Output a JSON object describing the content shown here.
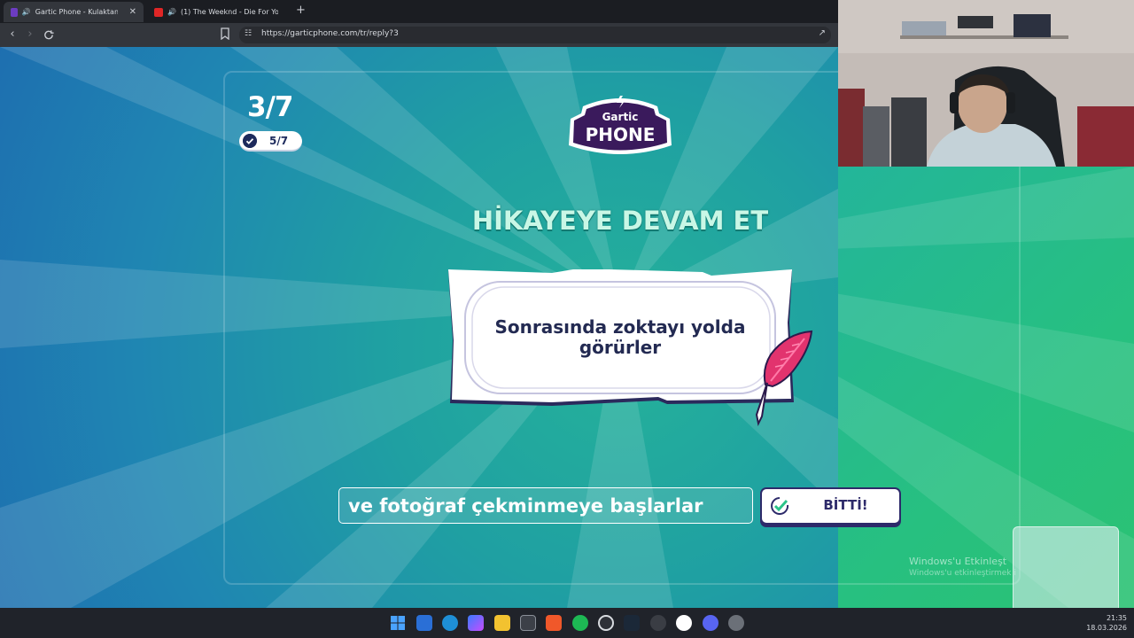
{
  "browser": {
    "tabs": [
      {
        "title": "Gartic Phone - Kulaktan Kulağ",
        "active": true,
        "favicon_color": "#6c3cc2"
      },
      {
        "title": "(1) The Weeknd - Die For You (Ly",
        "active": false,
        "favicon_color": "#e02626"
      }
    ],
    "new_tab": "+",
    "url": "https://garticphone.com/tr/reply?3"
  },
  "game": {
    "round_counter": "3/7",
    "done_count": "5/7",
    "logo_top": "Gartic",
    "logo_bottom": "PHONE",
    "heading": "HİKAYEYE DEVAM ET",
    "prompt_text": "Sonrasında zoktayı yolda görürler",
    "answer_value": "ve fotoğraf çekminmeye başlarlar",
    "done_button_label": "BİTTİ!",
    "colors": {
      "accent": "#2d2a6a",
      "heading": "#c9f7e6",
      "bg_teal": "#1fa0a2",
      "bg_blue": "#1e6fb0"
    }
  },
  "windows_notice": {
    "title": "Windows'u Etkinleşt",
    "subtitle": "Windows'u etkinleştirmek i"
  },
  "taskbar": {
    "icons": [
      "windows-start-icon",
      "mail-icon",
      "edge-icon",
      "copilot-icon",
      "file-explorer-icon",
      "store-icon",
      "brave-icon",
      "spotify-icon",
      "obs-icon",
      "steam-icon",
      "app-icon",
      "app-icon-2",
      "discord-icon",
      "settings-icon"
    ],
    "time": "21:35",
    "date": "18.03.2026"
  }
}
